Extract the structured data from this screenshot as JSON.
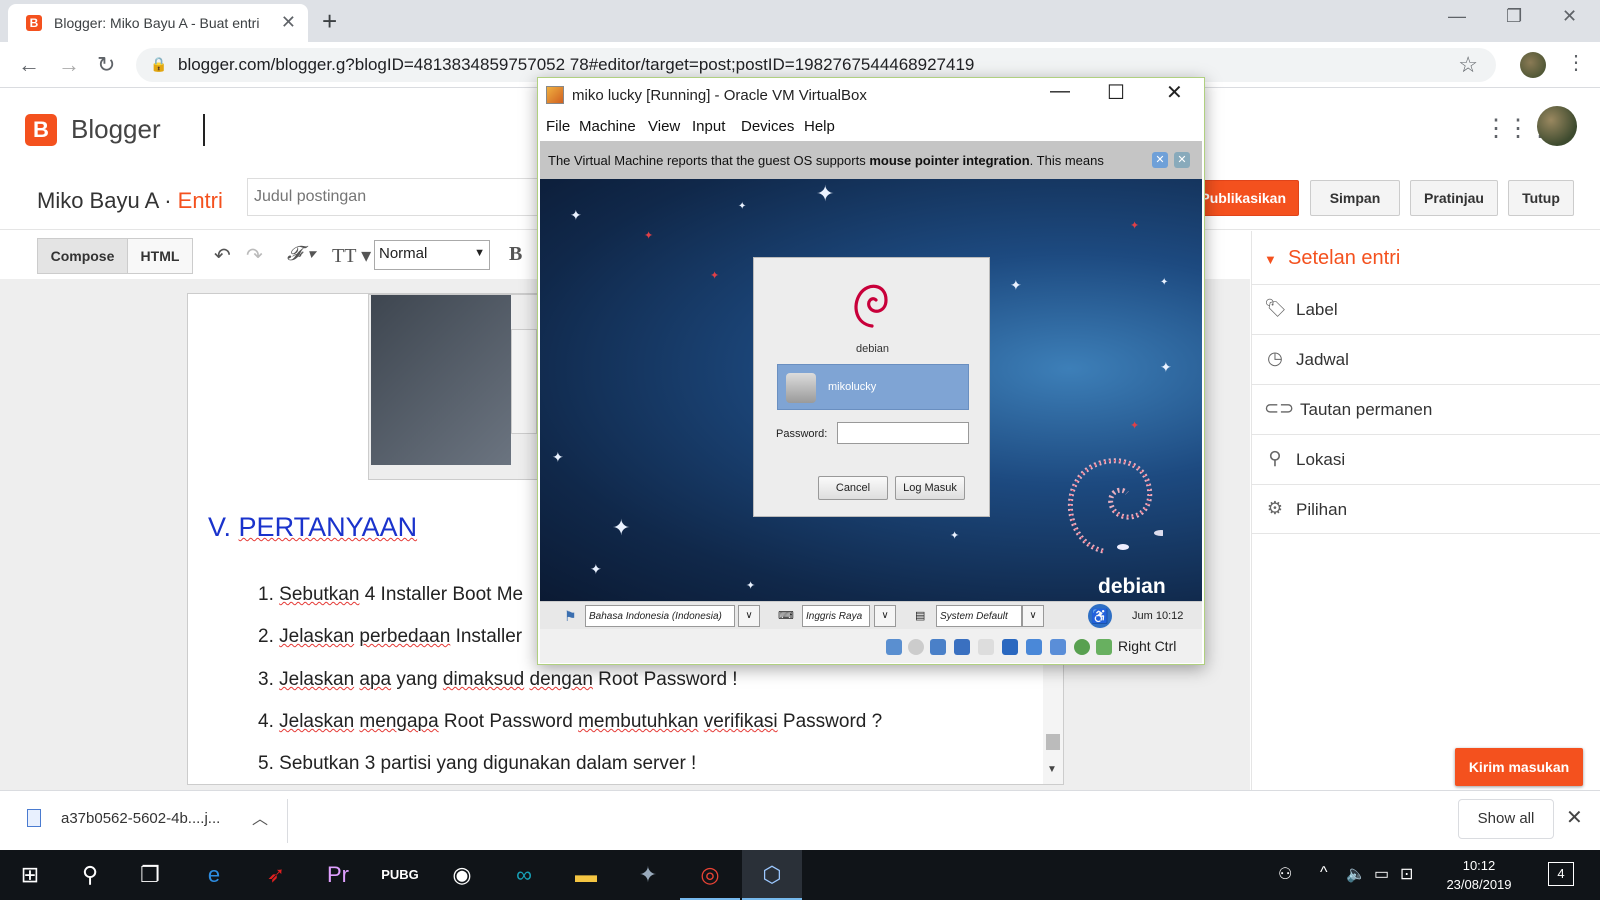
{
  "browser": {
    "tab_title": "Blogger: Miko Bayu A - Buat entri",
    "url": "blogger.com/blogger.g?blogID=4813834859757052 78#editor/target=post;postID=1982767544468927419"
  },
  "blogger": {
    "brand": "Blogger",
    "blog_name": "Miko Bayu A",
    "separator": " · ",
    "section": "Entri",
    "post_title_placeholder": "Judul postingan",
    "buttons": {
      "publish": "Publikasikan",
      "save": "Simpan",
      "preview": "Pratinjau",
      "close": "Tutup"
    },
    "modes": {
      "compose": "Compose",
      "html": "HTML"
    },
    "format_value": "Normal",
    "bold": "B"
  },
  "post": {
    "heading_prefix": "V. ",
    "heading_word": "PERTANYAAN",
    "questions": [
      {
        "num": "1.",
        "parts": [
          [
            "Sebutkan",
            true
          ],
          [
            " 4 Installer Boot Me",
            false
          ]
        ]
      },
      {
        "num": "2.",
        "parts": [
          [
            "Jelaskan",
            true
          ],
          [
            " ",
            false
          ],
          [
            "perbedaan",
            true
          ],
          [
            " Installer",
            false
          ]
        ]
      },
      {
        "num": "3.",
        "parts": [
          [
            "Jelaskan",
            true
          ],
          [
            " ",
            false
          ],
          [
            "apa",
            true
          ],
          [
            " yang ",
            false
          ],
          [
            "dimaksud",
            true
          ],
          [
            " ",
            false
          ],
          [
            "dengan",
            true
          ],
          [
            " Root Password !",
            false
          ]
        ]
      },
      {
        "num": "4.",
        "parts": [
          [
            "Jelaskan",
            true
          ],
          [
            " ",
            false
          ],
          [
            "mengapa",
            true
          ],
          [
            " Root Password ",
            false
          ],
          [
            "membutuhkan",
            true
          ],
          [
            " ",
            false
          ],
          [
            "verifikasi",
            true
          ],
          [
            " Password ?",
            false
          ]
        ]
      },
      {
        "num": "5.",
        "parts": [
          [
            "Sebutkan 3 partisi yang digunakan dalam server !",
            false
          ]
        ]
      }
    ]
  },
  "sidebar": {
    "title": "Setelan entri",
    "items": [
      {
        "label": "Label",
        "icon": "tag-icon"
      },
      {
        "label": "Jadwal",
        "icon": "clock-icon"
      },
      {
        "label": "Tautan permanen",
        "icon": "link-icon"
      },
      {
        "label": "Lokasi",
        "icon": "location-pin-icon"
      },
      {
        "label": "Pilihan",
        "icon": "gear-icon"
      }
    ],
    "feedback": "Kirim masukan"
  },
  "download": {
    "filename": "a37b0562-5602-4b....j...",
    "show_all": "Show all"
  },
  "vbox": {
    "title": "miko lucky [Running] - Oracle VM VirtualBox",
    "menu": [
      "File",
      "Machine",
      "View",
      "Input",
      "Devices",
      "Help"
    ],
    "notice_pre": "The Virtual Machine reports that the guest OS supports ",
    "notice_bold": "mouse pointer integration",
    "notice_post": ". This means",
    "host_key": "Right Ctrl"
  },
  "guest": {
    "distro_small": "debian",
    "username": "mikolucky",
    "password_label": "Password:",
    "cancel": "Cancel",
    "login": "Log Masuk",
    "distro_big": "debian",
    "language": "Bahasa Indonesia (Indonesia)",
    "keyboard": "Inggris Raya",
    "session": "System Default",
    "clock": "Jum 10:12"
  },
  "taskbar": {
    "time": "10:12",
    "date": "23/08/2019",
    "notifications": "4"
  },
  "colors": {
    "blogger_orange": "#f4511e",
    "heading_blue": "#1a33cc"
  }
}
